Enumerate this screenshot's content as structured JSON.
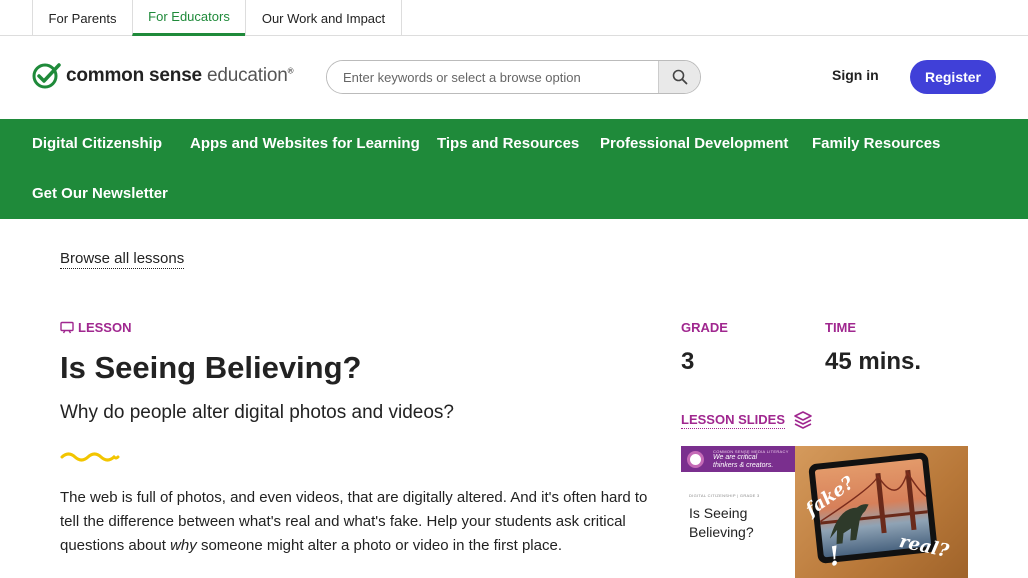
{
  "audience_tabs": [
    {
      "label": "For Parents",
      "active": false
    },
    {
      "label": "For Educators",
      "active": true
    },
    {
      "label": "Our Work and Impact",
      "active": false
    }
  ],
  "header": {
    "logo": {
      "brand": "common sense",
      "suffix": "education",
      "mark": "®"
    },
    "search": {
      "placeholder": "Enter keywords or select a browse option",
      "value": "",
      "button_icon": "search-icon"
    },
    "sign_in": "Sign in",
    "register": "Register"
  },
  "nav": {
    "items": [
      "Digital Citizenship",
      "Apps and Websites for Learning",
      "Tips and Resources",
      "Professional Development",
      "Family Resources",
      "Get Our Newsletter"
    ]
  },
  "breadcrumb": {
    "browse_label": "Browse all lessons"
  },
  "lesson": {
    "tag": "LESSON",
    "tag_icon": "presentation-icon",
    "title": "Is Seeing Believing?",
    "subtitle": "Why do people alter digital photos and videos?",
    "description_part1": "The web is full of photos, and even videos, that are digitally altered. And it's often hard to tell the difference between what's real and what's fake. Help your students ask critical questions about ",
    "description_em": "why",
    "description_part2": " someone might alter a photo or video in the first place."
  },
  "meta": {
    "grade_label": "GRADE",
    "grade_value": "3",
    "time_label": "TIME",
    "time_value": "45 mins."
  },
  "slides": {
    "label": "LESSON SLIDES",
    "icon": "layers-icon",
    "thumbnail": {
      "header_small": "COMMON SENSE MEDIA LITERACY",
      "header_line1": "We are critical",
      "header_line2": "thinkers & creators.",
      "category": "DIGITAL CITIZENSHIP | GRADE 3",
      "title": "Is Seeing Believing?",
      "scribble_fake": "fake?",
      "scribble_real": "real?",
      "scribble_bang": "!"
    }
  },
  "colors": {
    "brand_green": "#1f8a3a",
    "accent_purple": "#a0278f",
    "register_blue": "#4040d8",
    "squiggle_yellow": "#f2c500"
  }
}
